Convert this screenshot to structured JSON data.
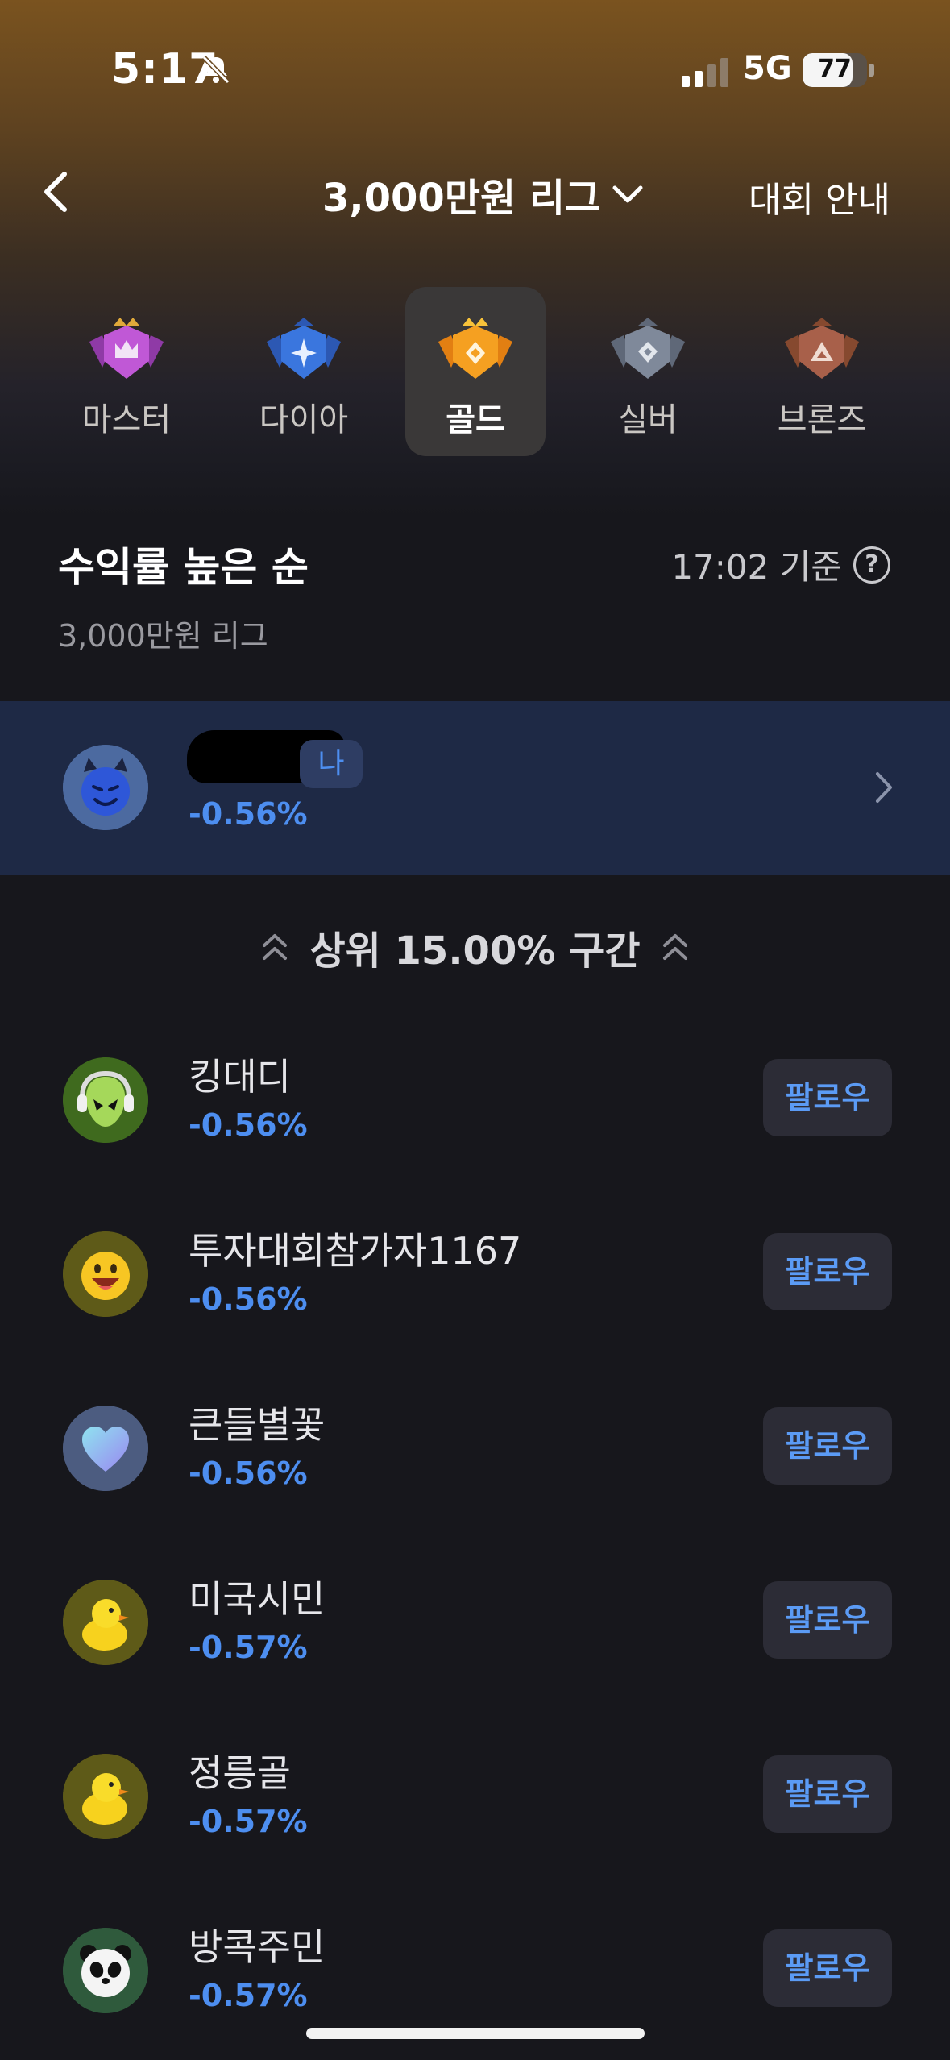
{
  "status_bar": {
    "time": "5:17",
    "network": "5G",
    "battery": "77",
    "battery_level": 0.77
  },
  "header": {
    "league": "3,000만원 리그",
    "guide": "대회 안내"
  },
  "tiers": [
    {
      "label": "마스터",
      "active": false,
      "color": "#b04ec4"
    },
    {
      "label": "다이아",
      "active": false,
      "color": "#3a6fd8"
    },
    {
      "label": "골드",
      "active": true,
      "color": "#f29a1c"
    },
    {
      "label": "실버",
      "active": false,
      "color": "#7a8496"
    },
    {
      "label": "브론즈",
      "active": false,
      "color": "#a8604a"
    }
  ],
  "ranking": {
    "title": "수익률 높은 순",
    "subtitle": "3,000만원 리그",
    "updated": "17:02 기준",
    "help": "?"
  },
  "me": {
    "badge": "나",
    "pct": "-0.56%",
    "avatar": "devil-emoji"
  },
  "range_label": "상위 15.00% 구간",
  "players": [
    {
      "name": "킹대디",
      "pct": "-0.56%",
      "follow": "팔로우",
      "avatar": "alien-emoji"
    },
    {
      "name": "투자대회참가자1167",
      "pct": "-0.56%",
      "follow": "팔로우",
      "avatar": "smile-emoji"
    },
    {
      "name": "큰들별꽃",
      "pct": "-0.56%",
      "follow": "팔로우",
      "avatar": "heart-emoji"
    },
    {
      "name": "미국시민",
      "pct": "-0.57%",
      "follow": "팔로우",
      "avatar": "chick-emoji"
    },
    {
      "name": "정릉골",
      "pct": "-0.57%",
      "follow": "팔로우",
      "avatar": "chick-emoji"
    },
    {
      "name": "방콕주민",
      "pct": "-0.57%",
      "follow": "팔로우",
      "avatar": "panda-emoji"
    }
  ]
}
